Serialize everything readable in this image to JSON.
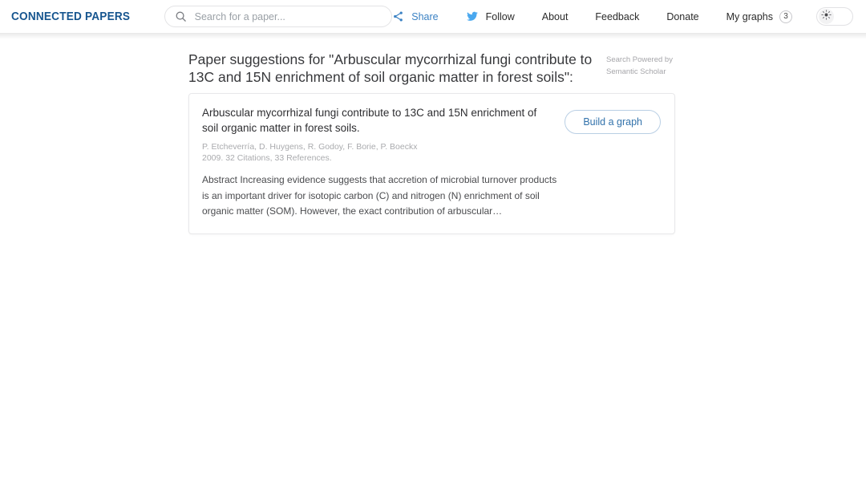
{
  "header": {
    "logo": "CONNECTED PAPERS",
    "logo_color": "#16558f",
    "search": {
      "placeholder": "Search for a paper...",
      "value": "",
      "icon": "search-icon"
    },
    "nav": [
      {
        "label": "Share",
        "icon": "share-icon",
        "color": "#3b82c4"
      },
      {
        "label": "Follow",
        "icon": "twitter-bird-icon",
        "color": "#2b2b2b"
      },
      {
        "label": "About",
        "icon": "",
        "color": "#2b2b2b"
      },
      {
        "label": "Feedback",
        "icon": "",
        "color": "#2b2b2b"
      },
      {
        "label": "Donate",
        "icon": "",
        "color": "#2b2b2b"
      },
      {
        "label": "My graphs",
        "icon": "",
        "color": "#2b2b2b",
        "badge": "3"
      }
    ],
    "theme_toggle": {
      "icon": "sun-icon",
      "state": "light"
    }
  },
  "main": {
    "page_title": "Paper suggestions for \"Arbuscular mycorrhizal fungi contribute to 13C and 15N enrichment of soil organic matter in forest soils\":",
    "powered_by": "Search Powered by Semantic Scholar",
    "results": [
      {
        "title": "Arbuscular mycorrhizal fungi contribute to 13C and 15N enrichment of soil organic matter in forest soils.",
        "authors": "P. Etcheverría, D. Huygens, R. Godoy, F. Borie, P. Boeckx",
        "meta": "2009. 32 Citations, 33 References.",
        "abstract": "Abstract Increasing evidence suggests that accretion of microbial turnover products is an important driver for isotopic carbon (C) and nitrogen (N) enrichment of soil organic matter (SOM). However, the exact contribution of arbuscular…",
        "action_label": "Build a graph"
      }
    ]
  }
}
